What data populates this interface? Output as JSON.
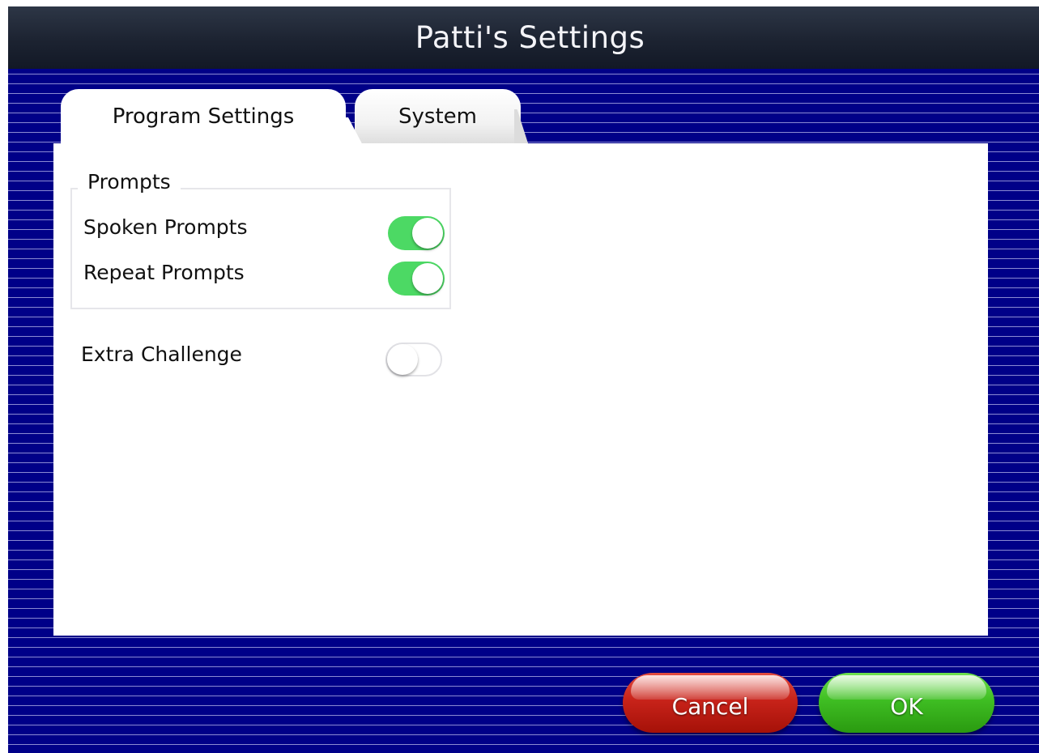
{
  "window": {
    "title": "Patti's Settings"
  },
  "tabs": [
    {
      "label": "Program Settings",
      "selected": true
    },
    {
      "label": "System",
      "selected": false
    }
  ],
  "prompts_group": {
    "legend": "Prompts",
    "items": [
      {
        "label": "Spoken Prompts",
        "enabled": true
      },
      {
        "label": "Repeat Prompts",
        "enabled": true
      }
    ]
  },
  "extra_challenge": {
    "label": "Extra Challenge",
    "enabled": false
  },
  "footer": {
    "cancel_label": "Cancel",
    "ok_label": "OK"
  },
  "colors": {
    "background": "#000088",
    "toggle_on": "#4cd964",
    "cancel_button": "#c8231a",
    "ok_button": "#3fbe23"
  }
}
